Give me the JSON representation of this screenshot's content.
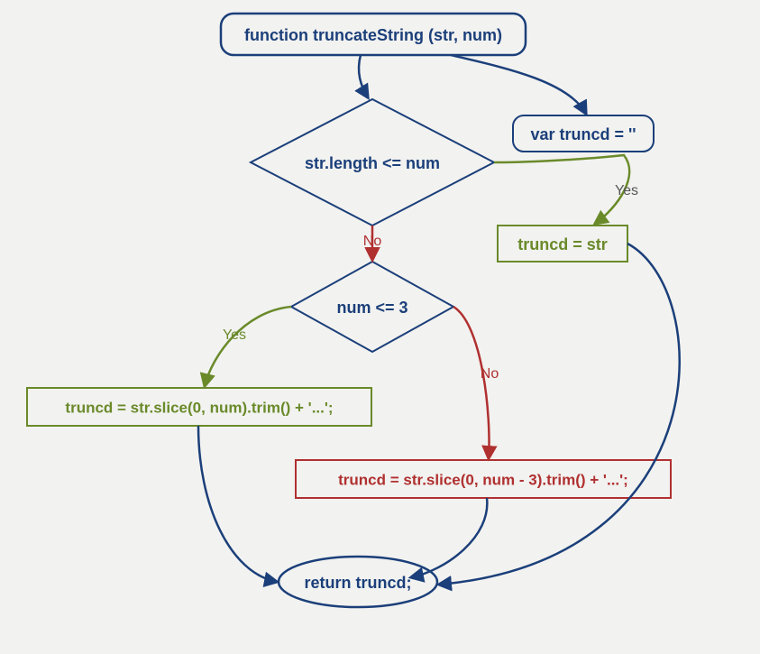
{
  "colors": {
    "blue": "#1b3f7a",
    "green": "#6a8a2a",
    "red": "#b03030",
    "gray": "#555555",
    "bg": "#f2f2f0"
  },
  "nodes": {
    "start": {
      "label": "function truncateString (str, num)"
    },
    "varDecl": {
      "label": "var truncd = ''"
    },
    "cond1": {
      "label": "str.length <= num"
    },
    "assign1": {
      "label": "truncd = str"
    },
    "cond2": {
      "label": "num <= 3"
    },
    "assign2": {
      "label": "truncd = str.slice(0, num).trim() + '...';"
    },
    "assign3": {
      "label": "truncd = str.slice(0, num - 3).trim() + '...';"
    },
    "ret": {
      "label": "return truncd;"
    }
  },
  "edges": {
    "c1_no": "No",
    "c1_yes": "Yes",
    "c2_yes": "Yes",
    "c2_no": "No"
  }
}
